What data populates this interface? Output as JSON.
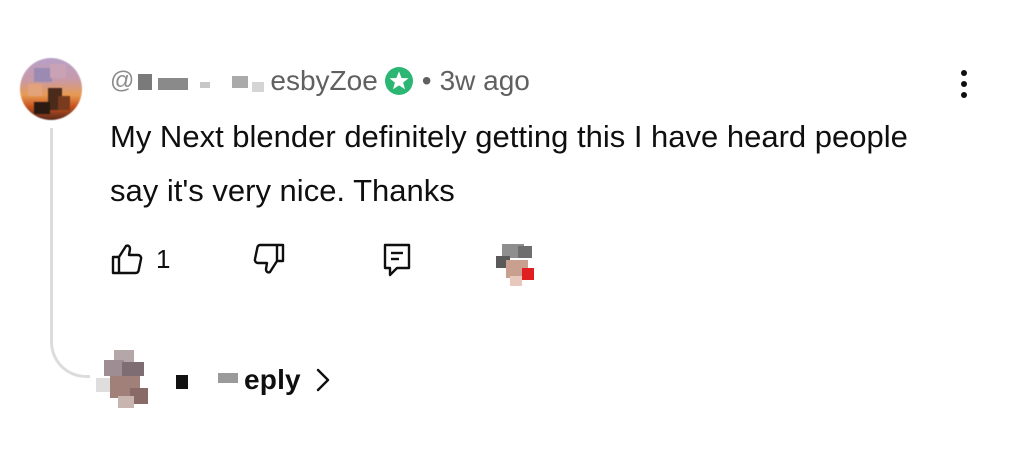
{
  "comment": {
    "handle_prefix": "@",
    "handle_suffix": "esbyZoe",
    "timestamp_sep": "•",
    "timestamp": "3w ago",
    "text": "My Next blender definitely getting this I have heard people say it's very nice. Thanks",
    "like_count": "1",
    "badge_color": "#2bb673"
  },
  "replies": {
    "label": "eply"
  },
  "icons": {
    "menu": "more-vertical-icon",
    "like": "thumbs-up-icon",
    "dislike": "thumbs-down-icon",
    "reply": "comment-icon",
    "badge": "star-badge-icon",
    "chevron": "chevron-right-icon"
  }
}
